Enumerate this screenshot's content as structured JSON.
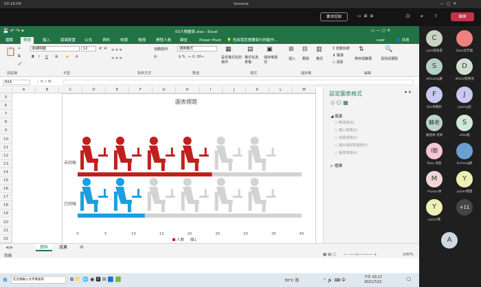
{
  "window": {
    "time": "02:16:04",
    "title": "General"
  },
  "meeting": {
    "request_control": "要求控制",
    "leave": "離開"
  },
  "excel": {
    "doc_title": "03人物圖表.xlsx - Excel",
    "tabs": [
      "檔案",
      "常用",
      "插入",
      "版面配置",
      "公式",
      "資料",
      "校閱",
      "檢視",
      "開發人員",
      "歸並",
      "Power Pivot"
    ],
    "search_hint": "告訴我您想要執行的動作...",
    "user": "user",
    "share": "共用",
    "font_name": "新細明體",
    "font_size": "12",
    "wrap": "自動換列",
    "num_format": "通用格式",
    "cond_format": "設定格式化的條件",
    "table_format": "格式化為表格",
    "cell_style": "儲存格樣式",
    "insert": "插入",
    "delete": "刪除",
    "format": "格式",
    "autosum": "自動加總",
    "fill": "填滿",
    "clear": "清除",
    "sort_filter": "排序與篩選",
    "find_select": "尋找與選取",
    "groups": {
      "clipboard": "剪貼簿",
      "font": "字型",
      "align": "對齊方式",
      "number": "數值",
      "style": "樣式",
      "cells": "儲存格",
      "edit": "編輯"
    },
    "name_box": "N14",
    "columns": [
      "A",
      "B",
      "C",
      "D",
      "E",
      "F",
      "G",
      "H",
      "I",
      "J",
      "K",
      "L",
      "M"
    ],
    "rows": [
      "5",
      "6",
      "7",
      "8",
      "9",
      "10",
      "11",
      "12",
      "13",
      "14",
      "15",
      "16",
      "17",
      "18",
      "19",
      "20",
      "21",
      "22"
    ],
    "sheets": [
      "資料",
      "成果"
    ],
    "status": "就緒",
    "zoom": "100%"
  },
  "chart_data": {
    "type": "bar",
    "title": "圖表標題",
    "categories": [
      "未回報",
      "已回報"
    ],
    "series": [
      {
        "name": "人數",
        "values": [
          24,
          12
        ]
      },
      {
        "name": "欄1",
        "values": [
          12,
          24
        ]
      }
    ],
    "xlim": [
      0,
      40
    ],
    "xticks": [
      "0",
      "5",
      "10",
      "15",
      "20",
      "25",
      "30",
      "35",
      "40"
    ],
    "colors": {
      "reported": "#1aa0e0",
      "unreported": "#c0201c",
      "remainder": "#d3d3d3"
    }
  },
  "pane": {
    "title": "設定圖表格式",
    "section_fill": "填滿",
    "section_border": "框線",
    "options": [
      "無填滿(N)",
      "實心填滿(S)",
      "漸層填滿(G)",
      "圖片或材質填滿(P)",
      "圖樣填滿(A)"
    ]
  },
  "taskbar": {
    "search": "在這裡輸入文字來搜尋",
    "temp": "30°C 雨",
    "time": "下午 03:17",
    "date": "2021/7/22"
  },
  "participants": [
    {
      "initial": "C",
      "name": "cylie張語萱",
      "color": "#c9d3c2"
    },
    {
      "initial": "",
      "name": "fywu沈芳瑜",
      "color": "#f08080"
    },
    {
      "initial": "S",
      "name": "shhuang黃",
      "color": "#b5cfc5"
    },
    {
      "initial": "D",
      "name": "dhtsai蔡東鴻",
      "color": "#cfe0d0"
    },
    {
      "initial": "F",
      "name": "fjlin林鳳鈴",
      "color": "#c7c9f0"
    },
    {
      "initial": "J",
      "name": "jupeng彭",
      "color": "#c7c9f0"
    },
    {
      "initial": "蘇老",
      "name": "蘇登奇 老師",
      "color": "#b9d3c9"
    },
    {
      "initial": "S",
      "name": "shliu劉",
      "color": "#cfe8d7"
    },
    {
      "initial": "l簡",
      "name": "llkao 高聖",
      "color": "#f4c7d2"
    },
    {
      "initial": "",
      "name": "lkcheng鄭",
      "color": "#6aa0d0"
    },
    {
      "initial": "M",
      "name": "miyayu余",
      "color": "#f0d5d5"
    },
    {
      "initial": "Y",
      "name": "yojian簡慧",
      "color": "#eef0b5"
    },
    {
      "initial": "Y",
      "name": "yujian簡",
      "color": "#eef0b5"
    },
    {
      "initial": "+11",
      "name": "",
      "color": "#444"
    },
    {
      "initial": "A",
      "name": "",
      "color": "#cfd8e0"
    }
  ]
}
